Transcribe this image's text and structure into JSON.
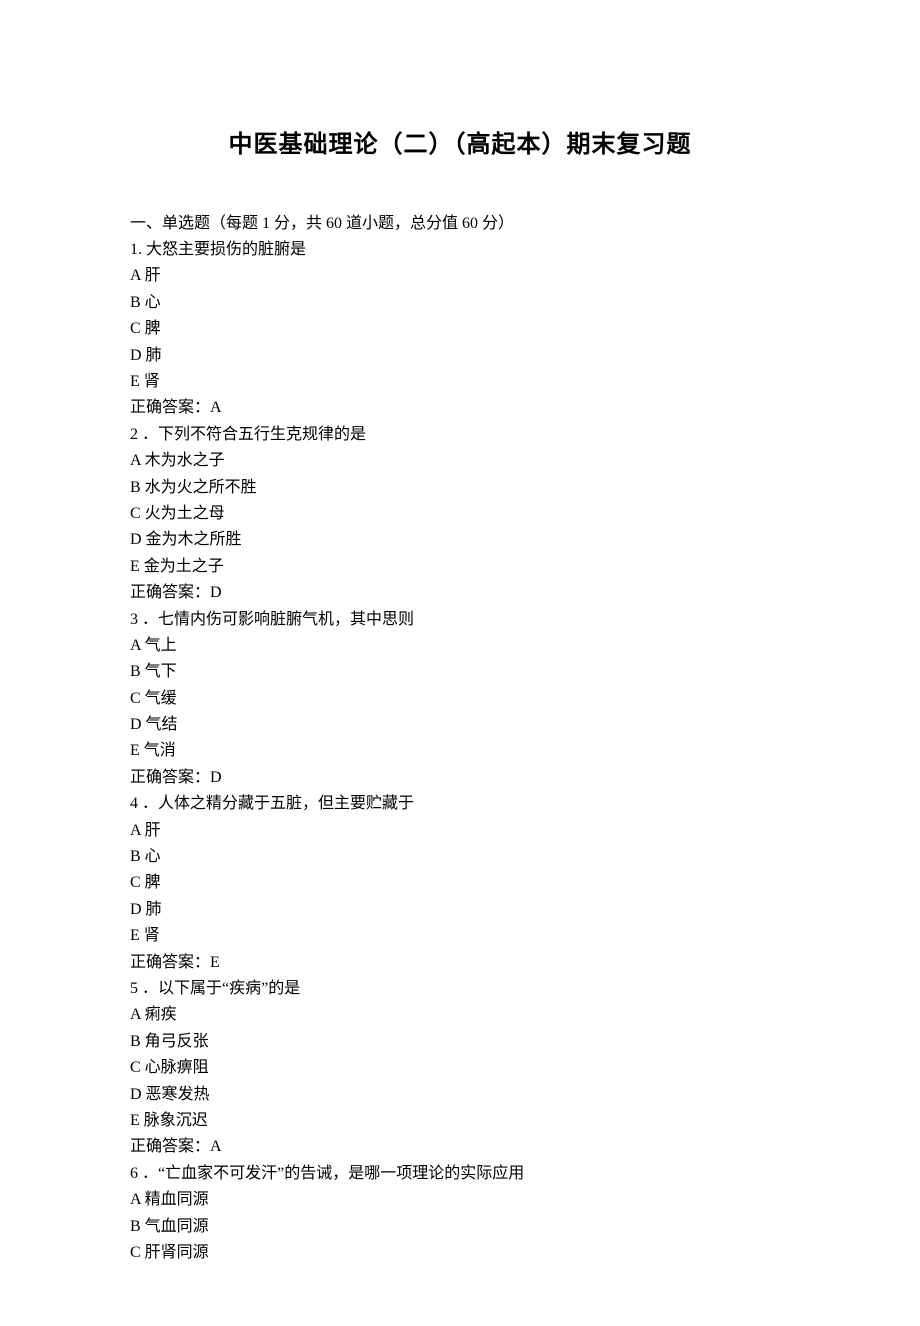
{
  "title": "中医基础理论（二）（高起本）期末复习题",
  "section_header": "一、单选题（每题 1 分，共 60 道小题，总分值 60 分）",
  "answer_label": "正确答案：",
  "questions": [
    {
      "num": "1.",
      "text": "大怒主要损伤的脏腑是",
      "options": [
        {
          "key": "A",
          "text": "肝"
        },
        {
          "key": "B",
          "text": "心"
        },
        {
          "key": "C",
          "text": "脾"
        },
        {
          "key": "D",
          "text": "肺"
        },
        {
          "key": "E",
          "text": "肾"
        }
      ],
      "answer": "A"
    },
    {
      "num": "2",
      "text": "．下列不符合五行生克规律的是",
      "options": [
        {
          "key": "A",
          "text": "木为水之子"
        },
        {
          "key": "B",
          "text": "水为火之所不胜"
        },
        {
          "key": "C",
          "text": "火为土之母"
        },
        {
          "key": "D",
          "text": "金为木之所胜"
        },
        {
          "key": "E",
          "text": "金为土之子"
        }
      ],
      "answer": "D"
    },
    {
      "num": "3",
      "text": "．七情内伤可影响脏腑气机，其中思则",
      "options": [
        {
          "key": "A",
          "text": "气上"
        },
        {
          "key": "B",
          "text": "气下"
        },
        {
          "key": "C",
          "text": "气缓"
        },
        {
          "key": "D",
          "text": "气结"
        },
        {
          "key": "E",
          "text": "气消"
        }
      ],
      "answer": "D"
    },
    {
      "num": "4",
      "text": "．人体之精分藏于五脏，但主要贮藏于",
      "options": [
        {
          "key": "A",
          "text": "肝"
        },
        {
          "key": "B",
          "text": "心"
        },
        {
          "key": "C",
          "text": "脾"
        },
        {
          "key": "D",
          "text": "肺"
        },
        {
          "key": "E",
          "text": "肾"
        }
      ],
      "answer": "E"
    },
    {
      "num": "5",
      "text": "．以下属于“疾病”的是",
      "options": [
        {
          "key": "A",
          "text": "痢疾"
        },
        {
          "key": "B",
          "text": "角弓反张"
        },
        {
          "key": "C",
          "text": "心脉痹阻"
        },
        {
          "key": "D",
          "text": "恶寒发热"
        },
        {
          "key": "E",
          "text": "脉象沉迟"
        }
      ],
      "answer": "A"
    },
    {
      "num": "6",
      "text": "．“亡血家不可发汗”的告诫，是哪一项理论的实际应用",
      "options": [
        {
          "key": "A",
          "text": "精血同源"
        },
        {
          "key": "B",
          "text": "气血同源"
        },
        {
          "key": "C",
          "text": "肝肾同源"
        }
      ],
      "answer": null
    }
  ]
}
